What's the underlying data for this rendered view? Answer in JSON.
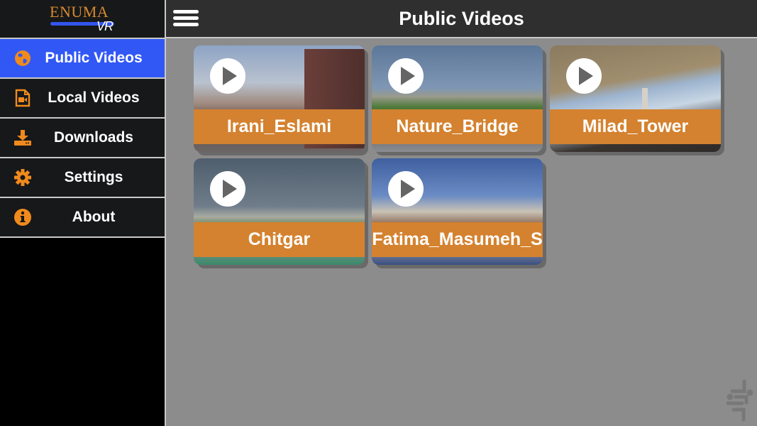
{
  "app": {
    "logo_text": "ENUMA",
    "logo_subtext": "VR"
  },
  "header": {
    "title": "Public Videos",
    "menu_icon": "hamburger-icon"
  },
  "sidebar": {
    "items": [
      {
        "label": "Public Videos",
        "icon": "globe-icon",
        "active": true
      },
      {
        "label": "Local Videos",
        "icon": "video-file-icon",
        "active": false
      },
      {
        "label": "Downloads",
        "icon": "download-icon",
        "active": false
      },
      {
        "label": "Settings",
        "icon": "gear-icon",
        "active": false
      },
      {
        "label": "About",
        "icon": "info-icon",
        "active": false
      }
    ]
  },
  "videos": [
    {
      "title": "Irani_Eslami"
    },
    {
      "title": "Nature_Bridge"
    },
    {
      "title": "Milad_Tower"
    },
    {
      "title": "Chitgar"
    },
    {
      "title": "Fatima_Masumeh_S"
    }
  ],
  "colors": {
    "accent": "#3158f5",
    "caption": "#d4822f",
    "icon": "#f08a1c",
    "background": "#8c8c8c"
  }
}
